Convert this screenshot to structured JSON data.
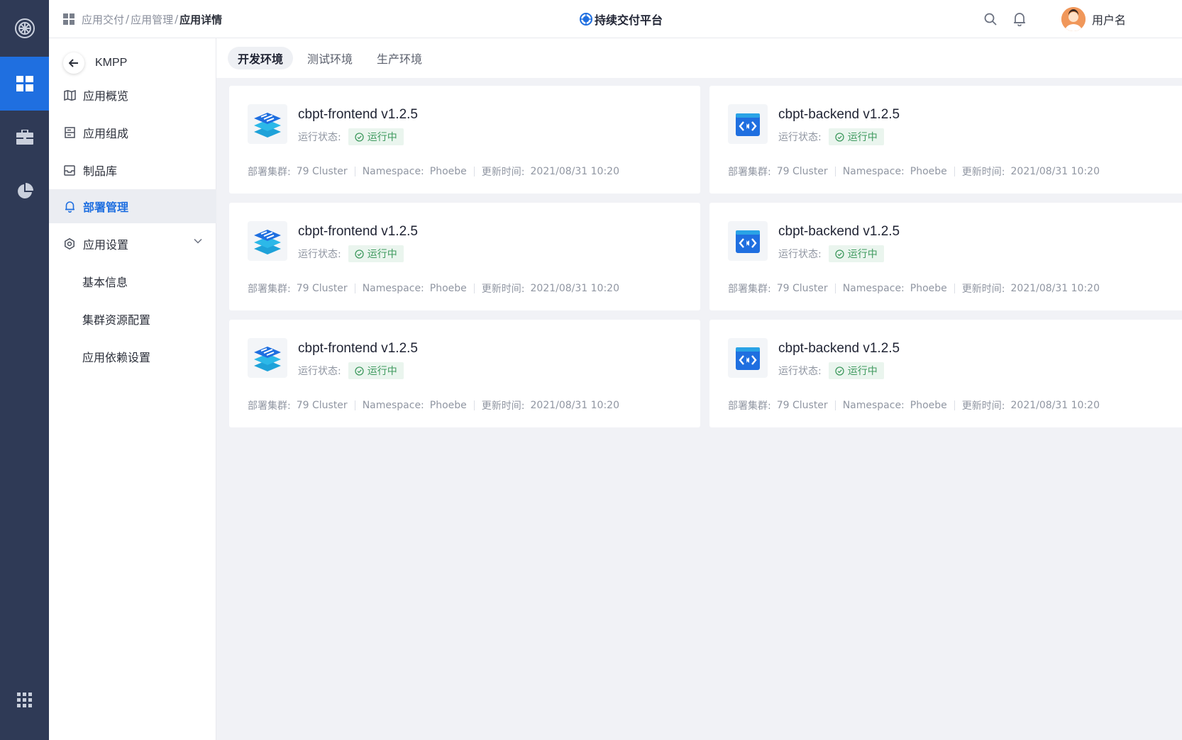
{
  "rail": {
    "items": [
      {
        "icon": "dashboard-icon",
        "active": true
      },
      {
        "icon": "toolbox-icon",
        "active": false
      },
      {
        "icon": "pie-chart-icon",
        "active": false
      }
    ],
    "bottom_icon": "apps-grid-icon"
  },
  "header": {
    "breadcrumb": [
      "应用交付",
      "应用管理",
      "应用详情"
    ],
    "brand": "持续交付平台",
    "username": "用户名"
  },
  "sidebar": {
    "app_name": "KMPP",
    "items": [
      {
        "label": "应用概览",
        "icon": "map-icon"
      },
      {
        "label": "应用组成",
        "icon": "composition-icon"
      },
      {
        "label": "制品库",
        "icon": "inbox-icon"
      },
      {
        "label": "部署管理",
        "icon": "bell-icon",
        "active": true
      },
      {
        "label": "应用设置",
        "icon": "settings-icon"
      }
    ],
    "sub_items": [
      "基本信息",
      "集群资源配置",
      "应用依赖设置"
    ]
  },
  "tabs": [
    "开发环境",
    "测试环境",
    "生产环境"
  ],
  "cards": [
    {
      "name": "cbpt-frontend v1.2.5",
      "type": "frontend",
      "status_label": "运行状态:",
      "status": "运行中",
      "cluster_label": "部署集群:",
      "cluster": "79 Cluster",
      "ns_label": "Namespace:",
      "namespace": "Phoebe",
      "time_label": "更新时间:",
      "updated": "2021/08/31 10:20"
    },
    {
      "name": "cbpt-backend v1.2.5",
      "type": "backend",
      "status_label": "运行状态:",
      "status": "运行中",
      "cluster_label": "部署集群:",
      "cluster": "79 Cluster",
      "ns_label": "Namespace:",
      "namespace": "Phoebe",
      "time_label": "更新时间:",
      "updated": "2021/08/31 10:20"
    },
    {
      "name": "cbpt-frontend v1.2.5",
      "type": "frontend",
      "status_label": "运行状态:",
      "status": "运行中",
      "cluster_label": "部署集群:",
      "cluster": "79 Cluster",
      "ns_label": "Namespace:",
      "namespace": "Phoebe",
      "time_label": "更新时间:",
      "updated": "2021/08/31 10:20"
    },
    {
      "name": "cbpt-backend v1.2.5",
      "type": "backend",
      "status_label": "运行状态:",
      "status": "运行中",
      "cluster_label": "部署集群:",
      "cluster": "79 Cluster",
      "ns_label": "Namespace:",
      "namespace": "Phoebe",
      "time_label": "更新时间:",
      "updated": "2021/08/31 10:20"
    },
    {
      "name": "cbpt-frontend v1.2.5",
      "type": "frontend",
      "status_label": "运行状态:",
      "status": "运行中",
      "cluster_label": "部署集群:",
      "cluster": "79 Cluster",
      "ns_label": "Namespace:",
      "namespace": "Phoebe",
      "time_label": "更新时间:",
      "updated": "2021/08/31 10:20"
    },
    {
      "name": "cbpt-backend v1.2.5",
      "type": "backend",
      "status_label": "运行状态:",
      "status": "运行中",
      "cluster_label": "部署集群:",
      "cluster": "79 Cluster",
      "ns_label": "Namespace:",
      "namespace": "Phoebe",
      "time_label": "更新时间:",
      "updated": "2021/08/31 10:20"
    }
  ],
  "colors": {
    "rail": "#2f3a56",
    "accent": "#1f6fe0",
    "status_green": "#3f9a5f",
    "status_bg": "#eaf5ee",
    "page_bg": "#f1f2f6"
  }
}
